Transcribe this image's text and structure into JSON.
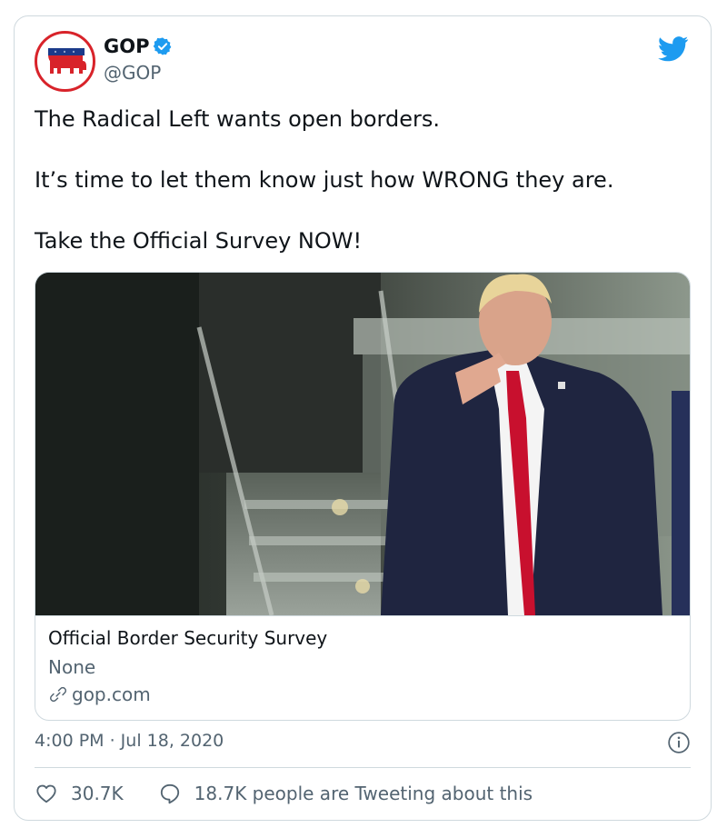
{
  "user": {
    "display_name": "GOP",
    "handle": "@GOP",
    "avatar_icon": "republican-elephant-icon",
    "verified": true
  },
  "tweet": {
    "lines": [
      "The Radical Left wants open borders.",
      "It’s time to let them know just how WRONG they are.",
      "Take the Official Survey NOW!"
    ]
  },
  "link_card": {
    "image_icon": "photo-man-pointing",
    "title": "Official Border Security Survey",
    "description": "None",
    "domain": "gop.com"
  },
  "meta": {
    "timestamp": "4:00 PM · Jul 18, 2020"
  },
  "stats": {
    "likes": "30.7K",
    "conversation": "18.7K people are Tweeting about this"
  },
  "colors": {
    "twitter_blue": "#1d9bf0",
    "gop_red": "#d8232a",
    "secondary_text": "#536471"
  }
}
